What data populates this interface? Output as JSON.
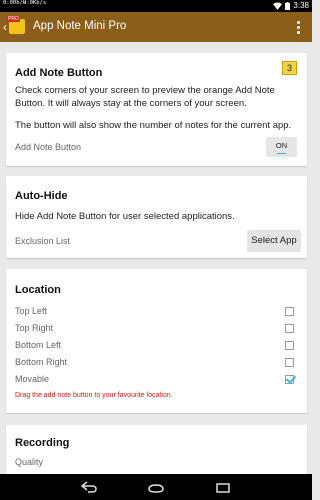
{
  "status_bar": {
    "net_up": "0:00b/s",
    "net_down": "U:0Kb/s",
    "time": "3:38",
    "wifi_icon": "wifi-icon",
    "battery_icon": "battery-icon"
  },
  "action_bar": {
    "title": "App Note Mini Pro",
    "badge": "PRO"
  },
  "add_note_button": {
    "title": "Add Note Button",
    "count": "3",
    "description": "Check corners of your screen to preview the orange Add Note Button. It will always stay at the corners of your screen.",
    "description2": "The button will also show the number of notes for the current app.",
    "toggle_label": "Add Note Button",
    "toggle_state": "ON"
  },
  "auto_hide": {
    "title": "Auto-Hide",
    "description": "Hide Add Note Button for user selected applications.",
    "exclusion_label": "Exclusion List",
    "select_button": "Select App"
  },
  "location": {
    "title": "Location",
    "options": [
      {
        "label": "Top Left",
        "checked": false
      },
      {
        "label": "Top Right",
        "checked": false
      },
      {
        "label": "Bottom Left",
        "checked": false
      },
      {
        "label": "Bottom Right",
        "checked": false
      },
      {
        "label": "Movable",
        "checked": true
      }
    ],
    "hint": "Drag the add note button to your favourite location."
  },
  "recording": {
    "title": "Recording",
    "quality_label": "Quality"
  },
  "colors": {
    "action_bar": "#8b5e1a",
    "accent": "#33b5e5",
    "hint": "#d0201a",
    "badge": "#f2d34a"
  }
}
